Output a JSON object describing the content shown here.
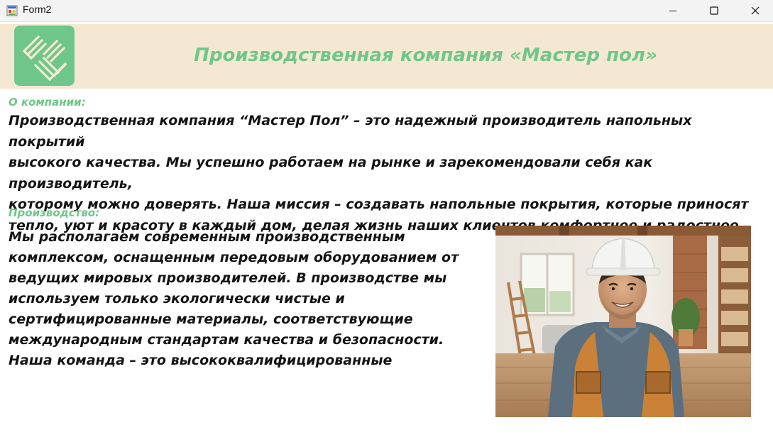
{
  "window": {
    "title": "Form2",
    "minimize_icon": "minimize-icon",
    "maximize_icon": "maximize-icon",
    "close_icon": "close-icon"
  },
  "header": {
    "logo_icon": "company-logo",
    "title": "Производственная компания «Мастер пол»"
  },
  "about": {
    "label": "О компании:",
    "lines": [
      "Производственная компания “Мастер Пол” – это надежный производитель напольных покрытий",
      "высокого качества. Мы успешно работаем на рынке и зарекомендовали себя как производитель,",
      "которому можно доверять. Наша миссия – создавать напольные покрытия, которые приносят",
      "тепло, уют и красоту в каждый дом, делая жизнь наших клиентов комфортнее и радостнее."
    ]
  },
  "production": {
    "label": "Производство:",
    "lines": [
      "Мы располагаем современным производственным",
      "комплексом, оснащенным передовым оборудованием от",
      "ведущих мировых производителей. В производстве мы",
      "используем только экологически чистые и",
      "сертифицированные материалы, соответствующие",
      "международным стандартам качества и безопасности.",
      "Наша команда – это высококвалифицированные"
    ],
    "photo": "worker-photo"
  },
  "colors": {
    "accent": "#6fc68a",
    "header_bg": "#f5e8d2",
    "text": "#141414"
  }
}
